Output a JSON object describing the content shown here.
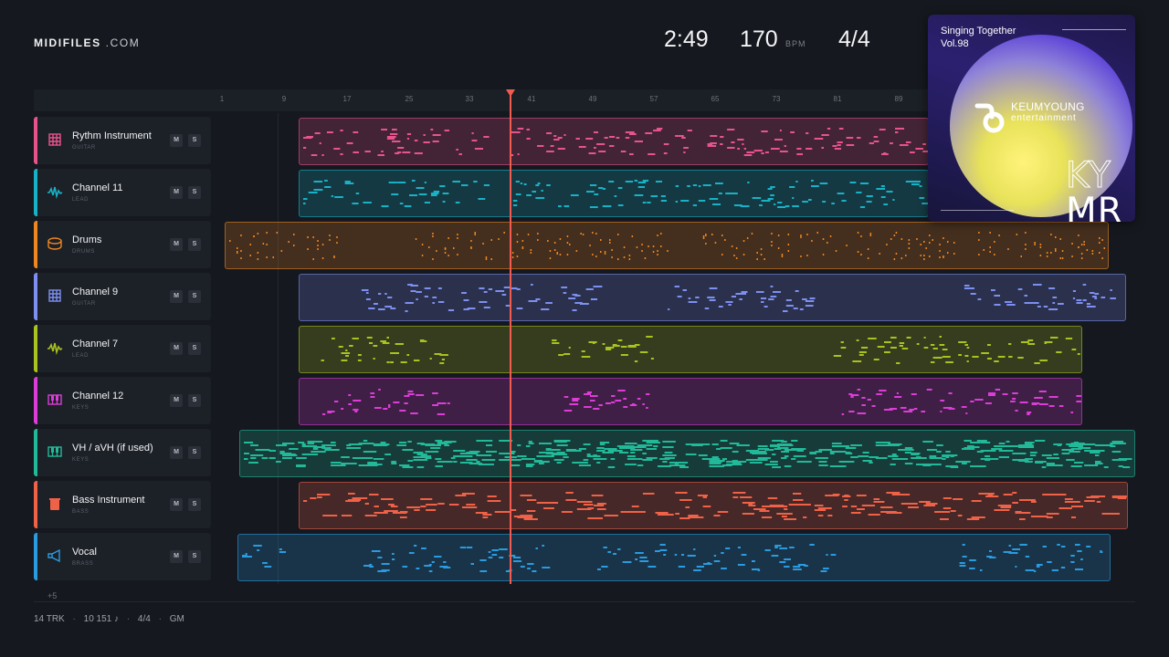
{
  "brand": {
    "name": "MIDIFILES",
    "suffix": ".COM"
  },
  "transport": {
    "time": "2:49",
    "bpm": "170",
    "bpm_unit": "BPM",
    "time_signature": "4/4"
  },
  "ruler": {
    "bars": [
      "1",
      "9",
      "17",
      "25",
      "33",
      "41",
      "49",
      "57",
      "65",
      "73",
      "81",
      "89"
    ]
  },
  "playhead_bar": 38,
  "tracks": [
    {
      "name": "Rythm Instrument",
      "type": "GUITAR",
      "icon": "guitar-grid-icon",
      "color": "#e7548c"
    },
    {
      "name": "Channel 11",
      "type": "LEAD",
      "icon": "waveform-icon",
      "color": "#19b1c6"
    },
    {
      "name": "Drums",
      "type": "DRUMS",
      "icon": "drum-icon",
      "color": "#ef8622"
    },
    {
      "name": "Channel 9",
      "type": "GUITAR",
      "icon": "guitar-grid-icon",
      "color": "#7d8ff0"
    },
    {
      "name": "Channel 7",
      "type": "LEAD",
      "icon": "waveform-icon",
      "color": "#a9c21f"
    },
    {
      "name": "Channel 12",
      "type": "KEYS",
      "icon": "piano-keys-icon",
      "color": "#dc3cd8"
    },
    {
      "name": "VH / aVH (if used)",
      "type": "KEYS",
      "icon": "piano-keys-icon",
      "color": "#22b999"
    },
    {
      "name": "Bass Instrument",
      "type": "BASS",
      "icon": "bass-speaker-icon",
      "color": "#f06248"
    },
    {
      "name": "Vocal",
      "type": "BRASS",
      "icon": "horn-icon",
      "color": "#2a9be0"
    }
  ],
  "track_buttons": {
    "mute": "M",
    "solo": "S"
  },
  "more_tracks": "+5",
  "footer": {
    "tracks": "14 TRK",
    "notes": "10 151 ♪",
    "signature": "4/4",
    "standard": "GM",
    "separator": "·"
  },
  "album": {
    "title_line1": "Singing Together",
    "title_line2": "Vol.98",
    "label_line1": "KEUMYOUNG",
    "label_line2": "entertainment",
    "big_line1": "KY",
    "big_line2": "MR"
  }
}
